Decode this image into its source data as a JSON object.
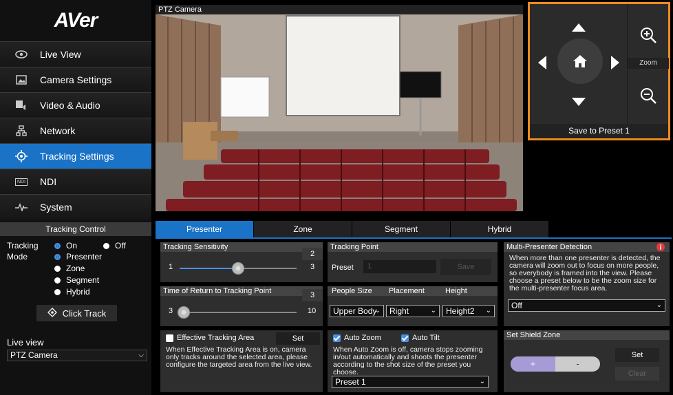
{
  "sidebar": {
    "logo": "AVer",
    "items": [
      {
        "label": "Live View",
        "icon": "eye-icon"
      },
      {
        "label": "Camera Settings",
        "icon": "image-icon"
      },
      {
        "label": "Video & Audio",
        "icon": "video-audio-icon"
      },
      {
        "label": "Network",
        "icon": "network-icon"
      },
      {
        "label": "Tracking Settings",
        "icon": "crosshair-icon",
        "active": true
      },
      {
        "label": "NDI",
        "icon": "ndi-icon"
      },
      {
        "label": "System",
        "icon": "pulse-icon"
      }
    ],
    "ndi_badge": "NDI"
  },
  "tracking_control": {
    "title": "Tracking Control",
    "mode_label_1": "Tracking",
    "mode_label_2": "Mode",
    "on_label": "On",
    "off_label": "Off",
    "modes": [
      "Presenter",
      "Zone",
      "Segment",
      "Hybrid"
    ],
    "selected_mode": "Presenter",
    "tracking_on": true,
    "click_track_label": "Click Track"
  },
  "live_view": {
    "label": "Live view",
    "selected": "PTZ Camera"
  },
  "camera": {
    "title": "PTZ Camera"
  },
  "ptz": {
    "zoom_label": "Zoom",
    "save_preset_label": "Save to Preset 1",
    "highlight_color": "#ef8a1e"
  },
  "tabs": [
    "Presenter",
    "Zone",
    "Segment",
    "Hybrid"
  ],
  "active_tab": "Presenter",
  "presenter": {
    "sensitivity": {
      "title": "Tracking Sensitivity",
      "value": "2",
      "min": "1",
      "max": "3",
      "level": 0.5
    },
    "return_time": {
      "title": "Time of Return to Tracking Point",
      "value": "3",
      "min": "3",
      "max": "10",
      "level": 0.0
    },
    "tracking_point": {
      "title": "Tracking Point",
      "preset_label": "Preset",
      "preset_value": "1",
      "save_label": "Save"
    },
    "people_size": {
      "size_label": "People Size",
      "placement_label": "Placement",
      "height_label": "Height",
      "size_value": "Upper Body",
      "placement_value": "Right",
      "height_value": "Height2"
    },
    "multi": {
      "title": "Multi-Presenter Detection",
      "description": "When more than one presenter is detected, the camera will zoom out to focus on more people, so everybody is framed into the view. Please choose a preset below to be the zoom size for the multi-presenter focus area.",
      "value": "Off"
    },
    "effective_area": {
      "label": "Effective Tracking Area",
      "checked": false,
      "set_label": "Set",
      "description": "When Effective Tracking Area is on, camera only tracks around the selected area, please configure the targeted area from the live view."
    },
    "auto": {
      "zoom_label": "Auto Zoom",
      "tilt_label": "Auto Tilt",
      "zoom_checked": true,
      "tilt_checked": true,
      "description": "When Auto Zoom is off, camera stops zooming in/out automatically and shoots the presenter according to the shot size of the preset you choose.",
      "preset_value": "Preset 1"
    },
    "shield": {
      "title": "Set Shield Zone",
      "plus": "+",
      "minus": "-",
      "set_label": "Set",
      "clear_label": "Clear"
    }
  },
  "colors": {
    "accent": "#1a73c7",
    "ptz_border": "#ef8a1e"
  }
}
